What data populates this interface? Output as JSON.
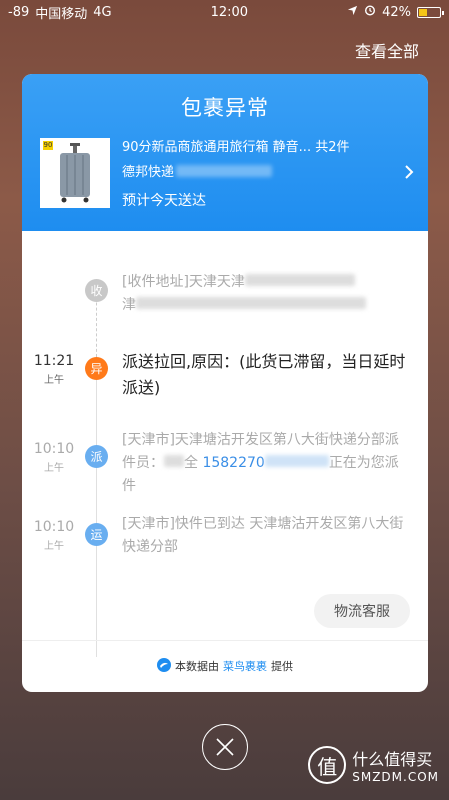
{
  "status_bar": {
    "signal": "-89",
    "carrier": "中国移动",
    "network": "4G",
    "time": "12:00",
    "battery": "42%",
    "battery_level": 0.42
  },
  "top_action": {
    "view_all": "查看全部"
  },
  "card": {
    "title": "包裹异常",
    "product": {
      "thumb_tag": "90",
      "name": "90分新品商旅通用旅行箱 静音... 共2件",
      "courier": "德邦快递",
      "eta": "预计今天送达"
    },
    "timeline": [
      {
        "time": "",
        "ampm": "",
        "node": "收",
        "text_a": "[收件地址]天津天津",
        "text_b": "津",
        "state": "address"
      },
      {
        "time": "11:21",
        "ampm": "上午",
        "node": "异",
        "text": "派送拉回,原因：(此货已滞留，当日延时派送)",
        "state": "exception"
      },
      {
        "time": "10:10",
        "ampm": "上午",
        "node": "派",
        "text_a": "[天津市]天津塘沽开发区第八大街快递分部派件员：",
        "text_b": "全",
        "phone": "1582270",
        "text_c": "正在为您派件",
        "state": "delivering"
      },
      {
        "time": "10:10",
        "ampm": "上午",
        "node": "运",
        "text": "[天津市]快件已到达 天津塘沽开发区第八大街快递分部",
        "state": "transit"
      }
    ],
    "service_button": "物流客服",
    "footer": {
      "prefix": "本数据由",
      "link": "菜鸟裹裹",
      "suffix": "提供"
    }
  },
  "watermark": {
    "title": "什么值得买",
    "subtitle": "SMZDM.COM",
    "logo_char": "值"
  },
  "colors": {
    "header_blue": "#1e8df0",
    "exception_orange": "#ff7a1a",
    "node_blue": "#69aef0"
  }
}
